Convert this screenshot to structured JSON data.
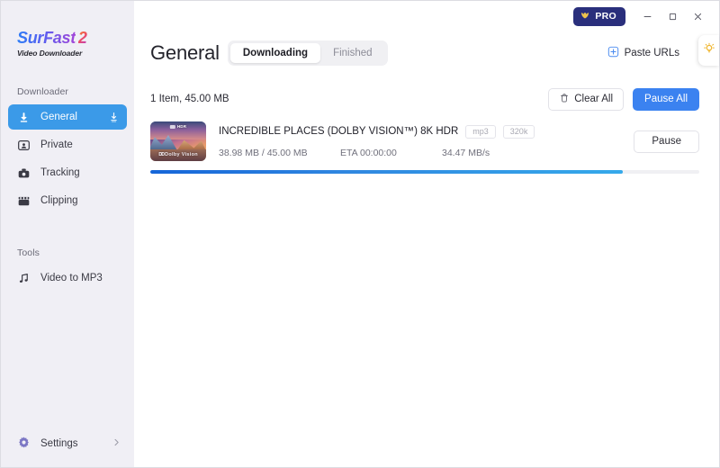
{
  "sidebar": {
    "logo": {
      "name": "SurFast",
      "version": "2",
      "subtitle": "Video Downloader"
    },
    "section_downloader": "Downloader",
    "section_tools": "Tools",
    "downloader_items": [
      {
        "label": "General",
        "icon": "download-arrow-icon",
        "active": true,
        "trailing_icon": "download-tray-icon"
      },
      {
        "label": "Private",
        "icon": "private-person-icon",
        "active": false
      },
      {
        "label": "Tracking",
        "icon": "tracking-camera-icon",
        "active": false
      },
      {
        "label": "Clipping",
        "icon": "clapperboard-icon",
        "active": false
      }
    ],
    "tools_items": [
      {
        "label": "Video to MP3",
        "icon": "music-note-icon"
      }
    ],
    "settings": {
      "label": "Settings",
      "icon": "gear-icon",
      "chevron": "chevron-right-icon"
    }
  },
  "titlebar": {
    "pro_label": "PRO",
    "pro_icon": "crown-icon",
    "minimize": "–",
    "maximize": "□",
    "close": "✕"
  },
  "header": {
    "title": "General",
    "tabs": [
      {
        "label": "Downloading",
        "active": true
      },
      {
        "label": "Finished",
        "active": false
      }
    ],
    "paste_urls_label": "Paste URLs",
    "paste_urls_icon": "plus-square-icon",
    "tip_icon": "lightbulb-icon"
  },
  "toolbar": {
    "summary": "1 Item, 45.00 MB",
    "clear_all_label": "Clear All",
    "clear_all_icon": "trash-icon",
    "pause_all_label": "Pause All"
  },
  "download": {
    "title": "INCREDIBLE PLACES (DOLBY VISION™) 8K HDR",
    "badges": [
      "mp3",
      "320k"
    ],
    "progress_text": "38.98 MB / 45.00 MB",
    "eta_text": "ETA 00:00:00",
    "speed_text": "34.47 MB/s",
    "pause_label": "Pause",
    "progress_percent": 86,
    "thumbnail": {
      "hdr_label": "HDR",
      "dolby_label": "Dolby Vision",
      "dolby_mark": "ᴅᴅ"
    }
  },
  "colors": {
    "accent_blue": "#3b82f0",
    "active_nav": "#3b9ae8",
    "pro_navy": "#2a2f7c",
    "sidebar_bg": "#f0eff5",
    "progress_start": "#1565d8",
    "progress_end": "#35a9ea"
  }
}
